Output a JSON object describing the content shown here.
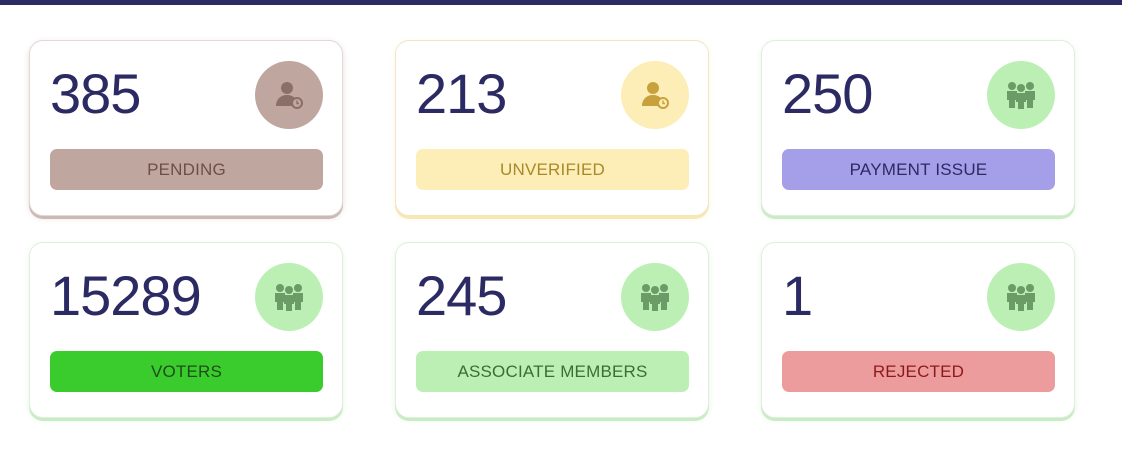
{
  "cards": [
    {
      "count": "385",
      "label": "PENDING",
      "icon": "user-clock-icon",
      "circle_color": "#bfa79f",
      "icon_color": "#8a6f66",
      "label_bg": "#bfa79f",
      "label_color": "#6d4f47"
    },
    {
      "count": "213",
      "label": "UNVERIFIED",
      "icon": "user-clock-icon",
      "circle_color": "#fdedb6",
      "icon_color": "#c9a13c",
      "label_bg": "#fdedb6",
      "label_color": "#a88a2a"
    },
    {
      "count": "250",
      "label": "PAYMENT ISSUE",
      "icon": "group-icon",
      "circle_color": "#bbefb4",
      "icon_color": "#6b9b66",
      "label_bg": "#a49fe8",
      "label_color": "#2c2a63"
    },
    {
      "count": "15289",
      "label": "VOTERS",
      "icon": "group-icon",
      "circle_color": "#bbefb4",
      "icon_color": "#6b9b66",
      "label_bg": "#3acb2d",
      "label_color": "#1f4d1a"
    },
    {
      "count": "245",
      "label": "ASSOCIATE MEMBERS",
      "icon": "group-icon",
      "circle_color": "#bbefb4",
      "icon_color": "#6b9b66",
      "label_bg": "#bbefb4",
      "label_color": "#3a6e34"
    },
    {
      "count": "1",
      "label": "REJECTED",
      "icon": "group-icon",
      "circle_color": "#bbefb4",
      "icon_color": "#6b9b66",
      "label_bg": "#ec9c9c",
      "label_color": "#8c1a1a"
    }
  ],
  "colors": {
    "top_bar": "#2c2a63",
    "count_text": "#2c2a63"
  }
}
